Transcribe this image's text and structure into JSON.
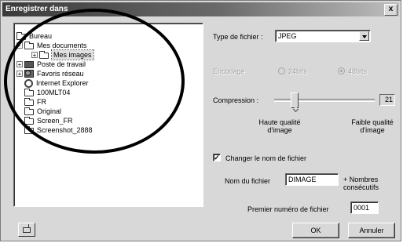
{
  "window": {
    "title": "Enregistrer dans",
    "close_glyph": "x"
  },
  "tree": {
    "items": [
      {
        "label": "Bureau",
        "icon": "desktop-folder-icon",
        "expander": ""
      },
      {
        "label": "Mes documents",
        "icon": "folder-open-icon",
        "expander": "-"
      },
      {
        "label": "Mes images",
        "icon": "folder-icon",
        "expander": "+",
        "selected": true
      },
      {
        "label": "Poste de travail",
        "icon": "computer-icon",
        "expander": "+"
      },
      {
        "label": "Favoris réseau",
        "icon": "network-icon",
        "expander": "+"
      },
      {
        "label": "Internet Explorer",
        "icon": "internet-explorer-icon",
        "expander": ""
      },
      {
        "label": "100MLT04",
        "icon": "folder-icon",
        "expander": ""
      },
      {
        "label": "FR",
        "icon": "folder-icon",
        "expander": ""
      },
      {
        "label": "Original",
        "icon": "folder-icon",
        "expander": ""
      },
      {
        "label": "Screen_FR",
        "icon": "folder-icon",
        "expander": ""
      },
      {
        "label": "Screenshot_2888",
        "icon": "folder-icon",
        "expander": ""
      }
    ]
  },
  "file_type": {
    "label": "Type de fichier :",
    "value": "JPEG"
  },
  "encoding": {
    "label": "Encodage",
    "option_24": "24bits",
    "option_48": "48bits",
    "selected": "48bits"
  },
  "compression": {
    "label": "Compression :",
    "value": "21",
    "fraction": 0.16,
    "high_quality_label": "Haute qualité\nd'image",
    "low_quality_label": "Faible qualité\nd'image"
  },
  "rename": {
    "checkbox_label": "Changer le nom de fichier",
    "checked": true,
    "check_glyph": "✓",
    "filename_label": "Nom du fichier",
    "filename_value": "DIMAGE",
    "consecutive_label": "+ Nombres\nconsécutifs",
    "first_number_label": "Premier numéro de fichier",
    "first_number_value": "0001"
  },
  "buttons": {
    "ok": "OK",
    "cancel": "Annuler"
  }
}
